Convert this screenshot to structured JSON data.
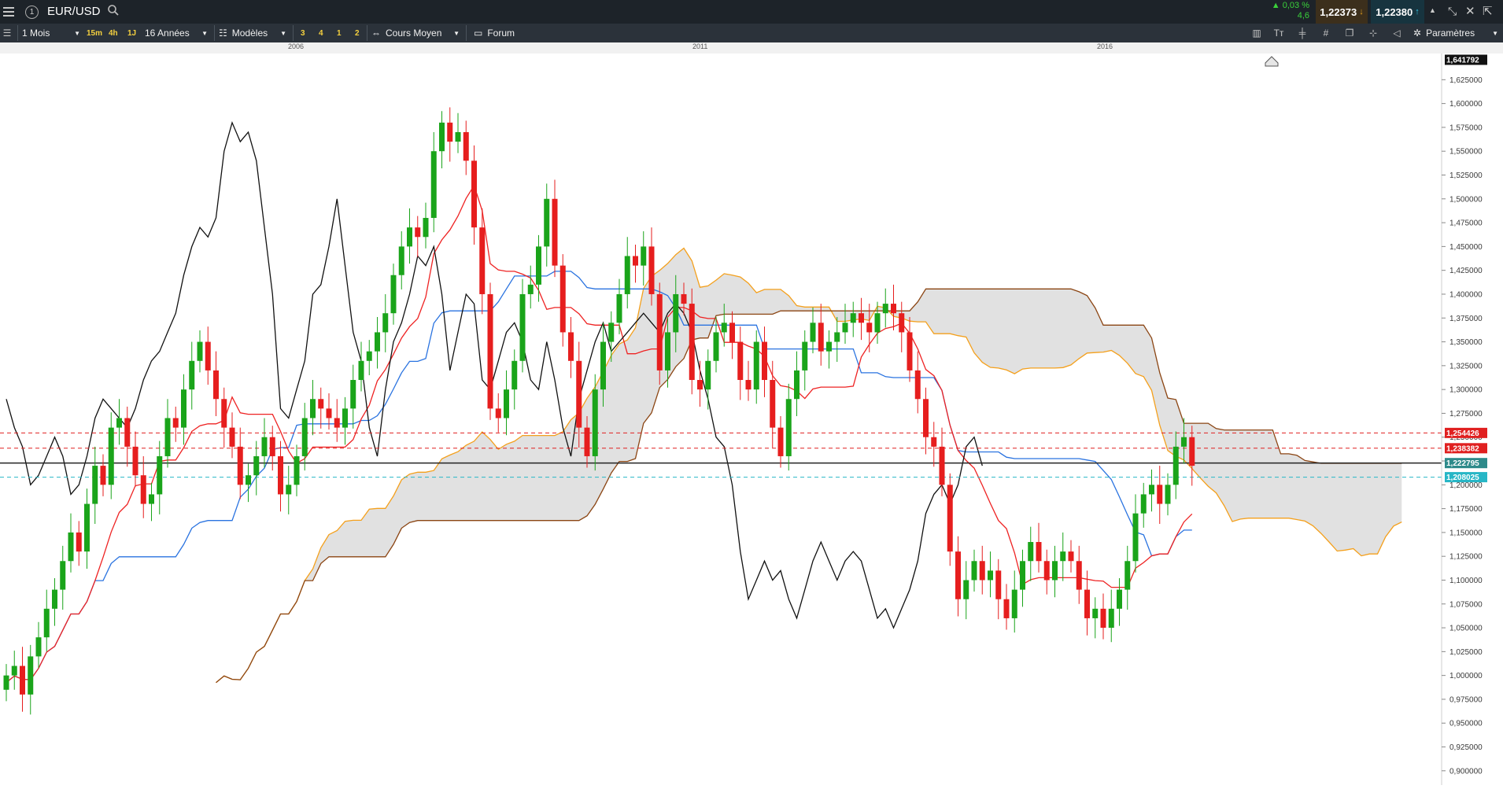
{
  "header": {
    "symbol": "EUR/USD",
    "change_pct": "0,03 %",
    "change_pts": "4,6",
    "bid": "1,22373",
    "ask": "1,22380"
  },
  "toolbar": {
    "period": "1 Mois",
    "timeframes": [
      "15m",
      "4h",
      "1J"
    ],
    "range": "16 Années",
    "models": "Modèles",
    "quick_layouts": [
      "3",
      "4",
      "1",
      "2"
    ],
    "price_type": "Cours Moyen",
    "forum": "Forum",
    "settings": "Paramètres"
  },
  "colors": {
    "up": "#1aa41a",
    "down": "#e61e1e",
    "tenkan": "#ee2222",
    "kijun": "#2a73e0",
    "chikou": "#111111",
    "span_a": "#f4a01c",
    "span_b": "#8b4513",
    "cloud": "#dcdcdc",
    "tag_red": "#e02020",
    "tag_teal": "#2e8a8a",
    "tag_cyan": "#27b6c6",
    "tag_black": "#111111"
  },
  "chart_data": {
    "type": "candlestick",
    "instrument": "EUR/USD",
    "timeframe": "monthly",
    "x_tick_labels": [
      "2006",
      "2011",
      "2016"
    ],
    "ylim": [
      0.885,
      1.6525
    ],
    "y_ticks": [
      0.9,
      0.925,
      0.95,
      0.975,
      1.0,
      1.025,
      1.05,
      1.075,
      1.1,
      1.125,
      1.15,
      1.175,
      1.2,
      1.225,
      1.25,
      1.275,
      1.3,
      1.325,
      1.35,
      1.375,
      1.4,
      1.425,
      1.45,
      1.475,
      1.5,
      1.525,
      1.55,
      1.575,
      1.6,
      1.625
    ],
    "y_tick_labels": [
      "0,900000",
      "0,925000",
      "0,950000",
      "0,975000",
      "1,000000",
      "1,025000",
      "1,050000",
      "1,075000",
      "1,100000",
      "1,125000",
      "1,150000",
      "1,175000",
      "1,200000",
      "1,225000",
      "1,250000",
      "1,275000",
      "1,300000",
      "1,325000",
      "1,350000",
      "1,375000",
      "1,400000",
      "1,425000",
      "1,450000",
      "1,475000",
      "1,500000",
      "1,525000",
      "1,550000",
      "1,575000",
      "1,600000",
      "1,625000"
    ],
    "price_tags": [
      {
        "label": "1,641792",
        "value": 1.641792,
        "color": "black"
      },
      {
        "label": "1,254426",
        "value": 1.254426,
        "color": "red"
      },
      {
        "label": "1,238382",
        "value": 1.238382,
        "color": "red"
      },
      {
        "label": "1,222795",
        "value": 1.222795,
        "color": "teal"
      },
      {
        "label": "1,208025",
        "value": 1.208025,
        "color": "cyan"
      }
    ],
    "horizontal_lines": [
      {
        "value": 1.254426,
        "style": "dashed",
        "color": "red"
      },
      {
        "value": 1.238382,
        "style": "dashed",
        "color": "red"
      },
      {
        "value": 1.2228,
        "style": "solid",
        "color": "black"
      },
      {
        "value": 1.208025,
        "style": "dashed",
        "color": "cyan"
      }
    ],
    "grid": false,
    "closes": [
      1.0,
      1.01,
      0.98,
      1.02,
      1.04,
      1.07,
      1.09,
      1.12,
      1.15,
      1.13,
      1.18,
      1.22,
      1.2,
      1.26,
      1.27,
      1.24,
      1.21,
      1.18,
      1.19,
      1.23,
      1.27,
      1.26,
      1.3,
      1.33,
      1.35,
      1.32,
      1.29,
      1.26,
      1.24,
      1.2,
      1.21,
      1.23,
      1.25,
      1.23,
      1.19,
      1.2,
      1.23,
      1.27,
      1.29,
      1.28,
      1.27,
      1.26,
      1.28,
      1.31,
      1.33,
      1.34,
      1.36,
      1.38,
      1.42,
      1.45,
      1.47,
      1.46,
      1.48,
      1.55,
      1.58,
      1.56,
      1.57,
      1.54,
      1.47,
      1.4,
      1.28,
      1.27,
      1.3,
      1.33,
      1.4,
      1.41,
      1.45,
      1.5,
      1.43,
      1.36,
      1.33,
      1.26,
      1.23,
      1.3,
      1.35,
      1.37,
      1.4,
      1.44,
      1.43,
      1.45,
      1.4,
      1.32,
      1.36,
      1.4,
      1.39,
      1.31,
      1.3,
      1.33,
      1.36,
      1.37,
      1.35,
      1.31,
      1.3,
      1.35,
      1.31,
      1.26,
      1.23,
      1.29,
      1.32,
      1.35,
      1.37,
      1.34,
      1.35,
      1.36,
      1.37,
      1.38,
      1.37,
      1.36,
      1.38,
      1.39,
      1.38,
      1.36,
      1.32,
      1.29,
      1.25,
      1.24,
      1.2,
      1.13,
      1.08,
      1.1,
      1.12,
      1.1,
      1.11,
      1.08,
      1.06,
      1.09,
      1.12,
      1.14,
      1.12,
      1.1,
      1.12,
      1.13,
      1.12,
      1.09,
      1.06,
      1.07,
      1.05,
      1.07,
      1.09,
      1.12,
      1.17,
      1.19,
      1.2,
      1.18,
      1.2,
      1.24,
      1.25,
      1.22
    ]
  }
}
